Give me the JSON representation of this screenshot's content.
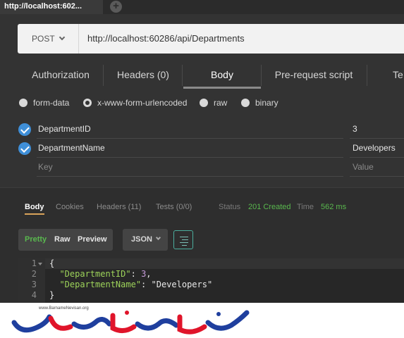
{
  "tab": {
    "title": "http://localhost:602...",
    "add_icon": "plus-icon"
  },
  "request": {
    "method": "POST",
    "url": "http://localhost:60286/api/Departments"
  },
  "request_tabs": [
    {
      "label": "Authorization",
      "active": false
    },
    {
      "label": "Headers (0)",
      "active": false
    },
    {
      "label": "Body",
      "active": true
    },
    {
      "label": "Pre-request script",
      "active": false
    },
    {
      "label": "Te",
      "active": false
    }
  ],
  "body_modes": [
    {
      "label": "form-data",
      "selected": false
    },
    {
      "label": "x-www-form-urlencoded",
      "selected": true
    },
    {
      "label": "raw",
      "selected": false
    },
    {
      "label": "binary",
      "selected": false
    }
  ],
  "params": [
    {
      "key": "DepartmentID",
      "value": "3",
      "checked": true
    },
    {
      "key": "DepartmentName",
      "value": "Developers",
      "checked": true
    }
  ],
  "params_placeholder": {
    "key": "Key",
    "value": "Value"
  },
  "response": {
    "tabs": [
      {
        "label": "Body",
        "active": true
      },
      {
        "label": "Cookies",
        "active": false
      },
      {
        "label": "Headers (11)",
        "active": false
      },
      {
        "label": "Tests (0/0)",
        "active": false
      }
    ],
    "status_label": "Status",
    "status_value": "201 Created",
    "time_label": "Time",
    "time_value": "562 ms",
    "view_modes": [
      "Pretty",
      "Raw",
      "Preview"
    ],
    "active_view": "Pretty",
    "format": "JSON",
    "code_lines": [
      {
        "n": "1",
        "text": "{"
      },
      {
        "n": "2",
        "key": "\"DepartmentID\"",
        "sep": ": ",
        "val": "3",
        "tail": ","
      },
      {
        "n": "3",
        "key": "\"DepartmentName\"",
        "sep": ": ",
        "val": "\"Developers\"",
        "tail": ""
      },
      {
        "n": "4",
        "text": "}"
      }
    ]
  },
  "watermark": {
    "url": "www.BarnameNevisan.org",
    "colors": {
      "blue": "#1f3f9e",
      "red": "#e0142a"
    }
  },
  "colors": {
    "accent": "#3f8fd8",
    "status_ok": "#59b84e",
    "json_key": "#9dd35a",
    "json_number": "#c59bd9"
  }
}
